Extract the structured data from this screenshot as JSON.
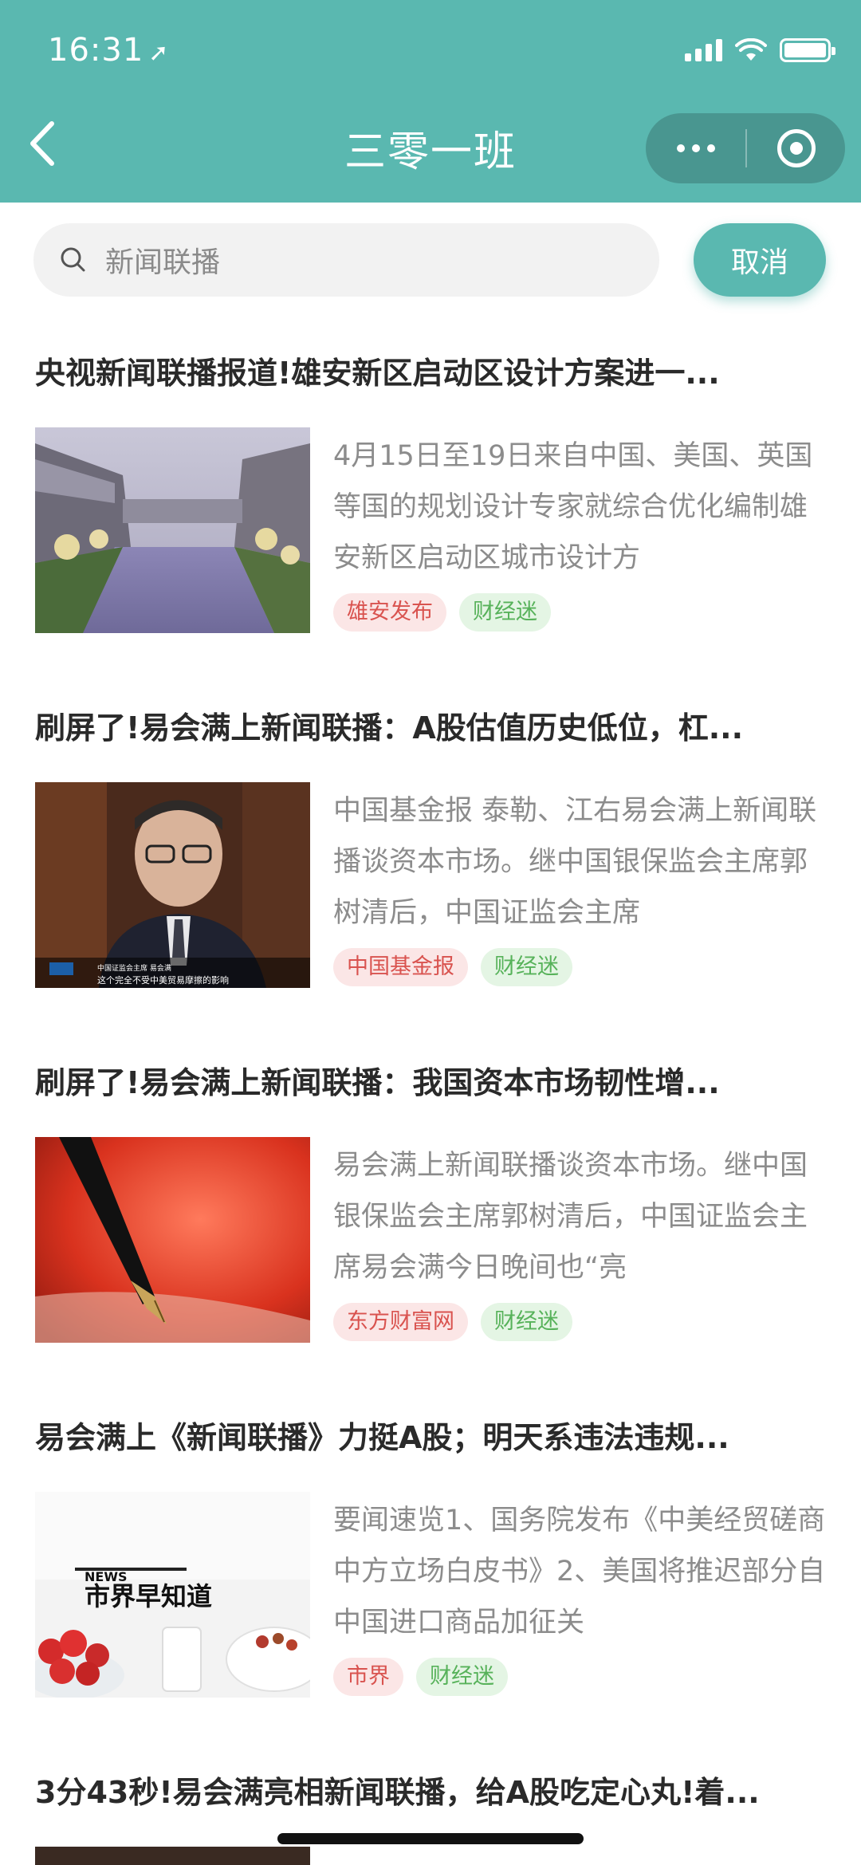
{
  "status_bar": {
    "time": "16:31"
  },
  "header": {
    "title": "三零一班"
  },
  "search": {
    "value": "新闻联播",
    "cancel_label": "取消"
  },
  "articles": [
    {
      "title": "央视新闻联播报道!雄安新区启动区设计方案进一...",
      "summary": "4月15日至19日来自中国、美国、英国等国的规划设计专家就综合优化编制雄安新区启动区城市设计方",
      "source_tag": "雄安发布",
      "category_tag": "财经迷"
    },
    {
      "title": "刷屏了!易会满上新闻联播：A股估值历史低位，杠...",
      "summary": "中国基金报 泰勒、江右易会满上新闻联播谈资本市场。继中国银保监会主席郭树清后，中国证监会主席",
      "source_tag": "中国基金报",
      "category_tag": "财经迷",
      "image_caption_1": "中国证监会主席 易会满",
      "image_caption_2": "这个完全不受中美贸易摩擦的影响"
    },
    {
      "title": "刷屏了!易会满上新闻联播：我国资本市场韧性增...",
      "summary": "易会满上新闻联播谈资本市场。继中国银保监会主席郭树清后，中国证监会主席易会满今日晚间也“亮",
      "source_tag": "东方财富网",
      "category_tag": "财经迷"
    },
    {
      "title": "易会满上《新闻联播》力挺A股；明天系违法违规...",
      "summary": "要闻速览1、国务院发布《中美经贸磋商中方立场白皮书》2、美国将推迟部分自中国进口商品加征关",
      "source_tag": "市界",
      "category_tag": "财经迷",
      "image_caption_1": "NEWS",
      "image_caption_2": "市界早知道"
    },
    {
      "title": "3分43秒!易会满亮相新闻联播，给A股吃定心丸!着..."
    }
  ],
  "colors": {
    "accent": "#5ab8b0",
    "tag_red": "#d9534f",
    "tag_green": "#57b25a"
  }
}
